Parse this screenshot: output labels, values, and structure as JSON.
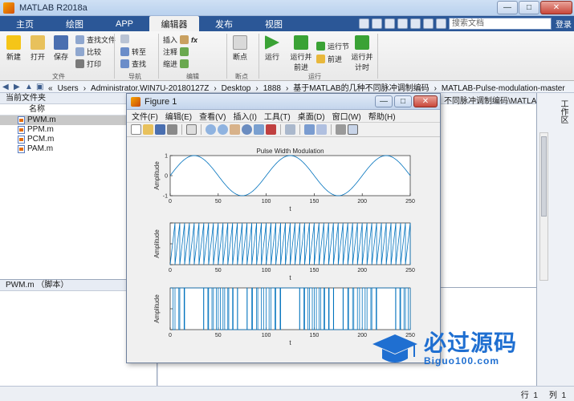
{
  "window": {
    "title": "MATLAB R2018a",
    "minimize": "—",
    "maximize": "□",
    "close": "✕"
  },
  "ribbon_tabs": [
    "主页",
    "绘图",
    "APP",
    "编辑器",
    "发布",
    "视图"
  ],
  "active_tab_index": 3,
  "search": {
    "placeholder": "搜索文档"
  },
  "help_link": "登录",
  "ribbon": {
    "file_group": {
      "new": "新建",
      "open": "打开",
      "save": "保存",
      "find_files": "查找文件",
      "compare": "比较",
      "print": "打印",
      "label": "文件"
    },
    "nav_group": {
      "goto": "转至",
      "find": "查找",
      "label": "导航"
    },
    "edit_group": {
      "insert": "插入",
      "comment": "注释",
      "indent": "缩进",
      "fx": "fx",
      "label": "编辑"
    },
    "breakpoints_group": {
      "breakpoints": "断点",
      "label": "断点"
    },
    "run_group": {
      "run": "运行",
      "run_advance": "运行并\n前进",
      "run_section": "运行节",
      "advance": "前进",
      "run_time": "运行并\n计时",
      "label": "运行"
    }
  },
  "address_path": [
    "«",
    "Users",
    "›",
    "Administrator.WIN7U-20180127Z",
    "›",
    "Desktop",
    "›",
    "1888",
    "›",
    "基于MATLAB的几种不同脉冲调制编码",
    "›",
    "MATLAB-Pulse-modulation-master"
  ],
  "left_panel": {
    "title": "当前文件夹",
    "column_name": "名称",
    "files": [
      "PWM.m",
      "PPM.m",
      "PCM.m",
      "PAM.m"
    ],
    "selected_index": 0,
    "details_title": "PWM.m （脚本）"
  },
  "right_panel_label": "工作区",
  "editor_path_fragment": "不同脉冲调制编码\\MATLA...",
  "status": {
    "row_label": "行",
    "row_value": "1",
    "col_label": "列",
    "col_value": "1"
  },
  "figure": {
    "title": "Figure 1",
    "menus": [
      "文件(F)",
      "编辑(E)",
      "查看(V)",
      "插入(I)",
      "工具(T)",
      "桌面(D)",
      "窗口(W)",
      "帮助(H)"
    ]
  },
  "chart_data": [
    {
      "type": "line",
      "title": "Pulse Width Modulation",
      "xlabel": "t",
      "ylabel": "Amplitude",
      "xlim": [
        0,
        250
      ],
      "ylim": [
        -1,
        1
      ],
      "xticks": [
        0,
        50,
        100,
        150,
        200,
        250
      ],
      "yticks": [
        -1,
        0,
        1
      ],
      "series": [
        {
          "kind": "sine",
          "amplitude": 1,
          "period": 100,
          "color": "#0072bd"
        }
      ]
    },
    {
      "type": "line",
      "title": "",
      "xlabel": "t",
      "ylabel": "Amplitude",
      "xlim": [
        0,
        250
      ],
      "ylim": [
        0,
        1
      ],
      "xticks": [
        0,
        50,
        100,
        150,
        200,
        250
      ],
      "yticks": [
        0,
        0.5,
        1
      ],
      "series": [
        {
          "kind": "sawtooth",
          "period": 5,
          "color": "#0072bd"
        }
      ]
    },
    {
      "type": "line",
      "title": "",
      "xlabel": "t",
      "ylabel": "Amplitude",
      "xlim": [
        0,
        250
      ],
      "ylim": [
        0,
        1
      ],
      "xticks": [
        0,
        50,
        100,
        150,
        200,
        250
      ],
      "yticks": [
        0,
        0.5,
        1
      ],
      "series": [
        {
          "kind": "pwm",
          "period": 5,
          "color": "#0072bd"
        }
      ]
    }
  ],
  "watermark": {
    "cn": "必过源码",
    "en": "Biguo100.com"
  },
  "colors": {
    "tab_bar": "#2b5797",
    "plot_line": "#0072bd"
  }
}
